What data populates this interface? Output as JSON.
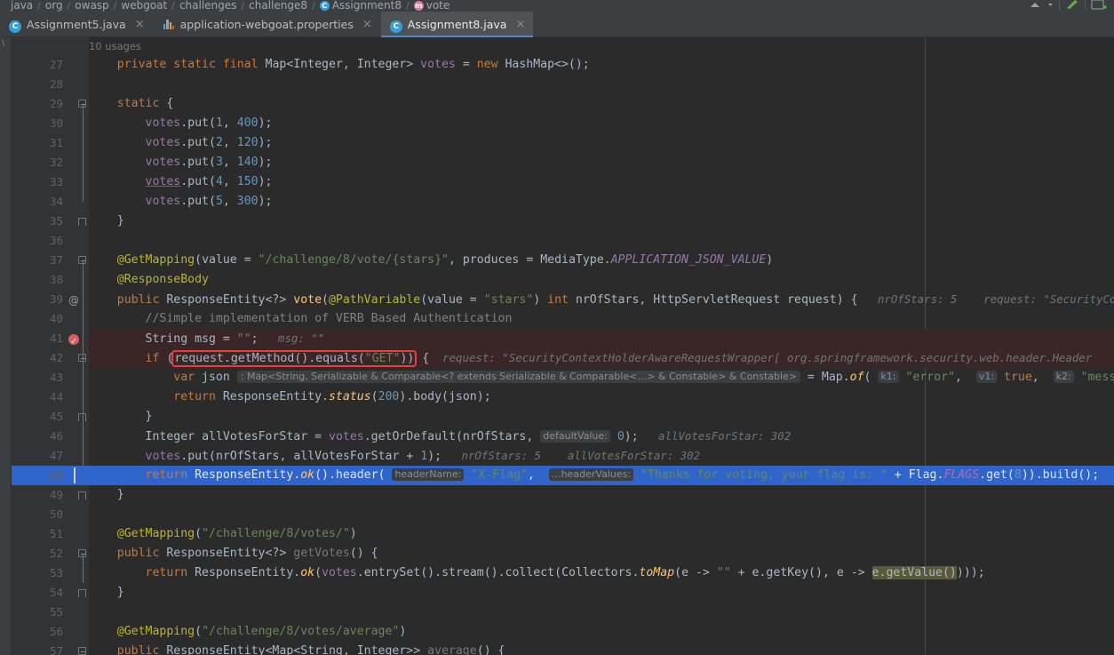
{
  "window": {
    "theme_accent": "#4a88c7",
    "editor_bg": "#2b2b2b",
    "chrome_bg": "#3c3f41"
  },
  "breadcrumb": {
    "items": [
      {
        "label": "java",
        "icon": ""
      },
      {
        "label": "org",
        "icon": ""
      },
      {
        "label": "owasp",
        "icon": ""
      },
      {
        "label": "webgoat",
        "icon": ""
      },
      {
        "label": "challenges",
        "icon": ""
      },
      {
        "label": "challenge8",
        "icon": ""
      },
      {
        "label": "Assignment8",
        "icon": "class-icon"
      },
      {
        "label": "vote",
        "icon": "method-icon"
      }
    ],
    "separator": "/"
  },
  "tabs": [
    {
      "label": "Assignment5.java",
      "icon": "java-class-icon",
      "close": "×",
      "active": false
    },
    {
      "label": "application-webgoat.properties",
      "icon": "properties-file-icon",
      "close": "×",
      "active": false
    },
    {
      "label": "Assignment8.java",
      "icon": "java-class-icon",
      "close": "×",
      "active": true
    }
  ],
  "editor": {
    "usages_hint": "10 usages",
    "lines": [
      {
        "n": "27",
        "text": "    private static final Map<Integer, Integer> votes = new HashMap<>();"
      },
      {
        "n": "28",
        "text": ""
      },
      {
        "n": "29",
        "text": "    static {"
      },
      {
        "n": "30",
        "text": "        votes.put(1, 400);"
      },
      {
        "n": "31",
        "text": "        votes.put(2, 120);"
      },
      {
        "n": "32",
        "text": "        votes.put(3, 140);"
      },
      {
        "n": "33",
        "text": "        votes.put(4, 150);"
      },
      {
        "n": "34",
        "text": "        votes.put(5, 300);"
      },
      {
        "n": "35",
        "text": "    }"
      },
      {
        "n": "36",
        "text": ""
      },
      {
        "n": "37",
        "text": "    @GetMapping(value = \"/challenge/8/vote/{stars}\", produces = MediaType.APPLICATION_JSON_VALUE)"
      },
      {
        "n": "38",
        "text": "    @ResponseBody"
      },
      {
        "n": "39",
        "text": "    public ResponseEntity<?> vote(@PathVariable(value = \"stars\") int nrOfStars, HttpServletRequest request) {"
      },
      {
        "n": "40",
        "text": "        //Simple implementation of VERB Based Authentication"
      },
      {
        "n": "41",
        "text": "        String msg = \"\";"
      },
      {
        "n": "42",
        "text": "        if (request.getMethod().equals(\"GET\")) {"
      },
      {
        "n": "43",
        "text": "            var json = Map.of(\"error\", true, \"message\""
      },
      {
        "n": "44",
        "text": "            return ResponseEntity.status(200).body(json);"
      },
      {
        "n": "45",
        "text": "        }"
      },
      {
        "n": "46",
        "text": "        Integer allVotesForStar = votes.getOrDefault(nrOfStars, 0);"
      },
      {
        "n": "47",
        "text": "        votes.put(nrOfStars, allVotesForStar + 1);"
      },
      {
        "n": "48",
        "text": "        return ResponseEntity.ok().header(\"X-Flag\", \"Thanks for voting, your flag is: \" + Flag.FLAGS.get(8)).build();"
      },
      {
        "n": "49",
        "text": "    }"
      },
      {
        "n": "50",
        "text": ""
      },
      {
        "n": "51",
        "text": "    @GetMapping(\"/challenge/8/votes/\")"
      },
      {
        "n": "52",
        "text": "    public ResponseEntity<?> getVotes() {"
      },
      {
        "n": "53",
        "text": "        return ResponseEntity.ok(votes.entrySet().stream().collect(Collectors.toMap(e -> \"\" + e.getKey(), e -> e.getValue())));"
      },
      {
        "n": "54",
        "text": "    }"
      },
      {
        "n": "55",
        "text": ""
      },
      {
        "n": "56",
        "text": "    @GetMapping(\"/challenge/8/votes/average\")"
      },
      {
        "n": "57",
        "text": "    public ResponseEntity<Map<String, Integer>> average() {"
      }
    ],
    "inlay_hints": {
      "line39_nrOfStars": "nrOfStars: 5",
      "line39_request": "request: \"SecurityCon",
      "line41_msg": "msg: \"\"",
      "line42_request": "request: \"SecurityContextHolderAwareRequestWrapper[ org.springframework.security.web.header.Header",
      "line43_type": ": Map<String, Serializable & Comparable<? extends Serializable & Comparable<…> & Constable> & Constable>",
      "line43_k1": "k1:",
      "line43_v1": "v1:",
      "line43_k2": "k2:",
      "line46_defaultValue": "defaultValue:",
      "line46_result": "allVotesForStar: 302",
      "line47_nrOfStars": "nrOfStars: 5",
      "line47_result": "allVotesForStar: 302",
      "line48_headerName": "headerName:",
      "line48_headerValues": "…headerValues:"
    },
    "tokens": {
      "l27": {
        "kw1": "private",
        "kw2": "static",
        "kw3": "final",
        "type": "Map<Integer, Integer>",
        "field": "votes",
        "eq": "=",
        "kw4": "new",
        "ctor": "HashMap<>();"
      },
      "l29": "static {",
      "l37_anno": "@GetMapping",
      "l37_value": "value",
      "l37_path": "\"/challenge/8/vote/{stars}\"",
      "l37_produces": "produces",
      "l37_mediatype": "MediaType.",
      "l37_const": "APPLICATION_JSON_VALUE",
      "l38_anno": "@ResponseBody",
      "l40_comment": "//Simple implementation of VERB Based Authentication",
      "l42_highlight": "request.getMethod().equals(\"GET\"))",
      "l53_occurrence": "e.getValue()"
    }
  }
}
